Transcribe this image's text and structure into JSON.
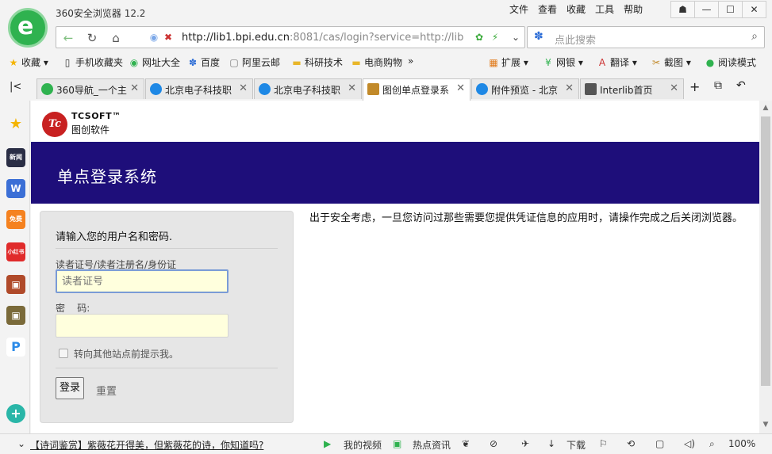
{
  "browser": {
    "app_title": "360安全浏览器 12.2",
    "menu": [
      "文件",
      "查看",
      "收藏",
      "工具",
      "帮助"
    ],
    "window_buttons": [
      "☗",
      "—",
      "☐",
      "✕"
    ],
    "url_host": "http://lib1.bpi.edu.cn",
    "url_rest": ":8081/cas/login?service=http://lib",
    "search_placeholder": "点此搜索"
  },
  "bookmarks": {
    "left": [
      {
        "icon": "★",
        "label": "收藏"
      },
      {
        "icon": "▯",
        "label": "手机收藏夹"
      },
      {
        "icon": "◉",
        "label": "网址大全"
      },
      {
        "icon": "✽",
        "label": "百度"
      },
      {
        "icon": "▢",
        "label": "阿里云邮"
      },
      {
        "icon": "▬",
        "label": "科研技术"
      },
      {
        "icon": "▬",
        "label": "电商购物"
      }
    ],
    "more": "»",
    "right": [
      {
        "icon": "▦",
        "label": "扩展"
      },
      {
        "icon": "¥",
        "label": "网银"
      },
      {
        "icon": "A",
        "label": "翻译"
      },
      {
        "icon": "✂",
        "label": "截图"
      },
      {
        "icon": "●",
        "label": "阅读模式"
      }
    ]
  },
  "tabs": [
    {
      "label": "360导航_一个主",
      "color": "#2fb24f"
    },
    {
      "label": "北京电子科技职",
      "color": "#1e88e5"
    },
    {
      "label": "北京电子科技职",
      "color": "#1e88e5"
    },
    {
      "label": "图创单点登录系",
      "color": "#c28a2a"
    },
    {
      "label": "附件预览 - 北京",
      "color": "#1e88e5"
    },
    {
      "label": "Interlib首页",
      "color": "#555555"
    }
  ],
  "tab_close": "✕",
  "sidebar_icons": [
    {
      "name": "favorites",
      "text": "★",
      "color": "#f4b400"
    },
    {
      "name": "news",
      "text": "新闻",
      "color": "#2a2e45"
    },
    {
      "name": "docs",
      "text": "W",
      "color": "#3b6fd6"
    },
    {
      "name": "novel",
      "text": "免费",
      "color": "#f58220"
    },
    {
      "name": "xiaohongshu",
      "text": "小红书",
      "color": "#e02b2b"
    },
    {
      "name": "game",
      "text": "▣",
      "color": "#b04a2a"
    },
    {
      "name": "game2",
      "text": "▣",
      "color": "#7a6a3a"
    },
    {
      "name": "pay",
      "text": "P",
      "color": "#2c8be8"
    }
  ],
  "page": {
    "brand": "TCSOFT™",
    "brand_sub": "图创软件",
    "logo_text": "Tc",
    "banner_title": "单点登录系统",
    "login": {
      "heading": "请输入您的用户名和密码.",
      "user_label": "读者证号/读者注册名/身份证",
      "user_placeholder": "读者证号",
      "password_label": "密    码:",
      "warn_label": "转向其他站点前提示我。",
      "login_button": "登录",
      "reset_button": "重置"
    },
    "notice": "出于安全考虑，一旦您访问过那些需要您提供凭证信息的应用时，请操作完成之后关闭浏览器。"
  },
  "status": {
    "news": "【诗词鉴赏】紫薇花开得美，但紫薇花的诗，你知道吗?",
    "video": "我的视频",
    "hot": "热点资讯",
    "download": "下载",
    "zoom": "100%"
  }
}
